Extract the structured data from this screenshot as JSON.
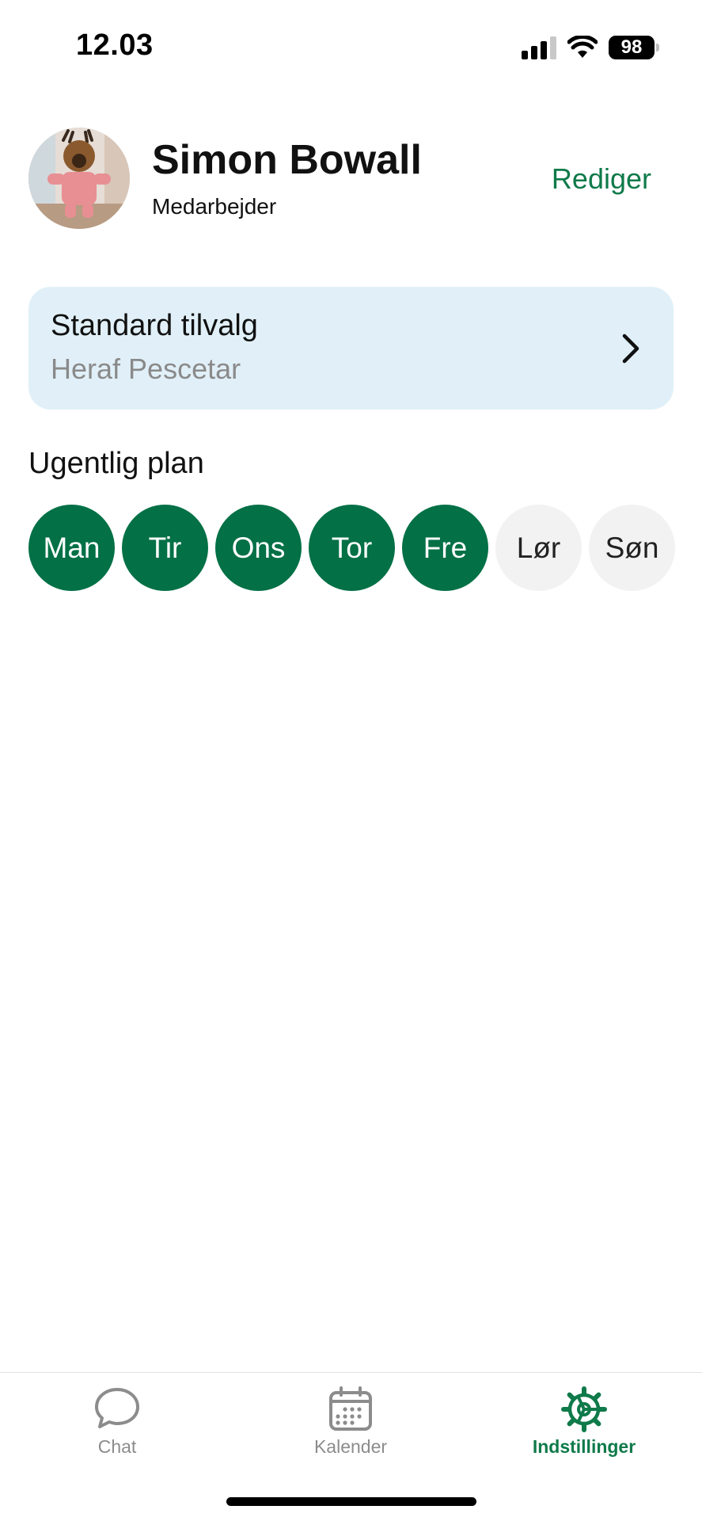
{
  "status_bar": {
    "time": "12.03",
    "battery": "98"
  },
  "profile": {
    "name": "Simon Bowall",
    "role": "Medarbejder",
    "edit_label": "Rediger"
  },
  "default_choice": {
    "title": "Standard tilvalg",
    "subtitle": "Heraf Pescetar"
  },
  "weekly_plan": {
    "title": "Ugentlig plan",
    "days": [
      {
        "label": "Man",
        "selected": true
      },
      {
        "label": "Tir",
        "selected": true
      },
      {
        "label": "Ons",
        "selected": true
      },
      {
        "label": "Tor",
        "selected": true
      },
      {
        "label": "Fre",
        "selected": true
      },
      {
        "label": "Lør",
        "selected": false
      },
      {
        "label": "Søn",
        "selected": false
      }
    ]
  },
  "tabs": [
    {
      "label": "Chat",
      "icon": "chat-bubble-icon",
      "active": false
    },
    {
      "label": "Kalender",
      "icon": "calendar-icon",
      "active": false
    },
    {
      "label": "Indstillinger",
      "icon": "gear-icon",
      "active": true
    }
  ],
  "colors": {
    "accent": "#0f7a4a",
    "day_selected": "#037046",
    "day_unselected": "#f2f2f2",
    "card_background": "#e1f0f8",
    "tab_inactive": "#8c8c8c"
  }
}
